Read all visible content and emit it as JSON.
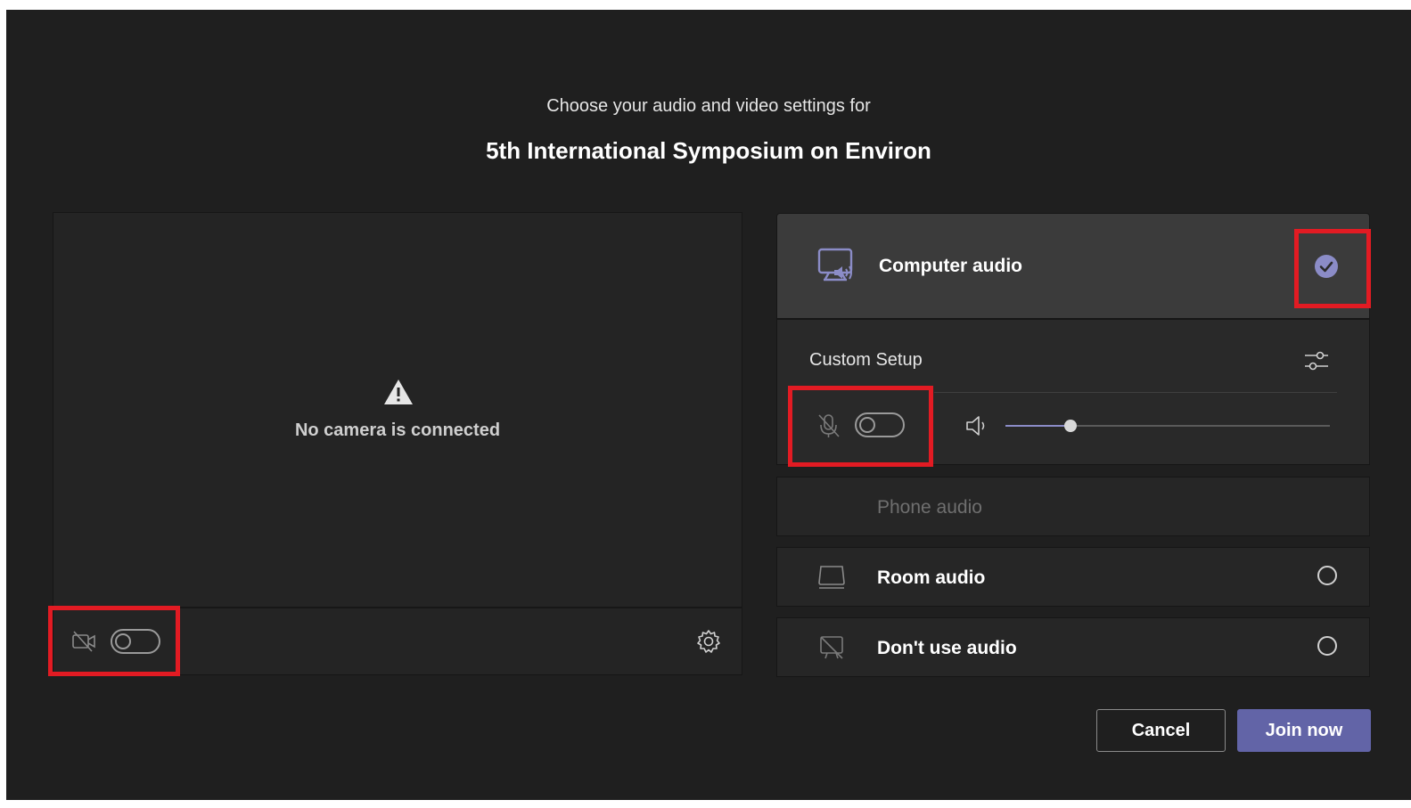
{
  "header": {
    "subtitle": "Choose your audio and video settings for",
    "meeting_title": "5th International Symposium on Environ"
  },
  "video": {
    "warning_icon": "warning-triangle-icon",
    "no_camera_text": "No camera is connected",
    "camera_toggle_on": false,
    "camera_icon": "camera-off-icon",
    "settings_icon": "gear-icon"
  },
  "audio": {
    "computer_audio": {
      "label": "Computer audio",
      "selected": true,
      "icon": "monitor-speaker-icon"
    },
    "custom_setup": {
      "label": "Custom Setup",
      "mic_toggle_on": false,
      "mic_icon": "mic-off-icon",
      "speaker_icon": "speaker-icon",
      "settings_icon": "sliders-icon",
      "volume_level": 0.2
    },
    "phone_audio": {
      "label": "Phone audio",
      "disabled": true
    },
    "room_audio": {
      "label": "Room audio",
      "selected": false,
      "icon": "room-audio-icon"
    },
    "no_audio": {
      "label": "Don't use audio",
      "selected": false,
      "icon": "no-audio-icon"
    }
  },
  "actions": {
    "cancel_label": "Cancel",
    "join_label": "Join now"
  },
  "colors": {
    "background": "#1f1f1f",
    "accent": "#6264a7",
    "highlight": "#e21b23",
    "selected_check": "#8b8cc7"
  }
}
